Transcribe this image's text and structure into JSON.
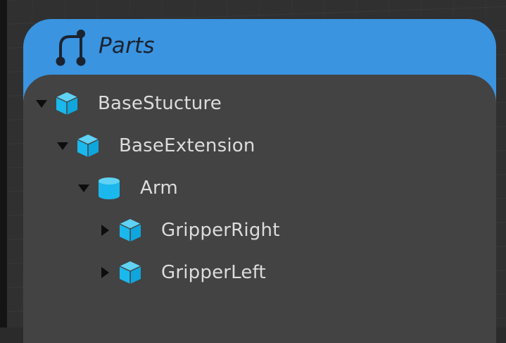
{
  "panel": {
    "title": "Parts",
    "title_icon": "hierarchy-icon",
    "header_color": "#3a94e0",
    "body_color": "#434343",
    "accent_icon_color": "#1ab8ec"
  },
  "tree": [
    {
      "label": "BaseStucture",
      "icon": "cube-icon",
      "expanded": true,
      "depth": 0
    },
    {
      "label": "BaseExtension",
      "icon": "cube-icon",
      "expanded": true,
      "depth": 1
    },
    {
      "label": "Arm",
      "icon": "cylinder-icon",
      "expanded": true,
      "depth": 2
    },
    {
      "label": "GripperRight",
      "icon": "cube-icon",
      "expanded": false,
      "depth": 3
    },
    {
      "label": "GripperLeft",
      "icon": "cube-icon",
      "expanded": false,
      "depth": 3
    }
  ]
}
